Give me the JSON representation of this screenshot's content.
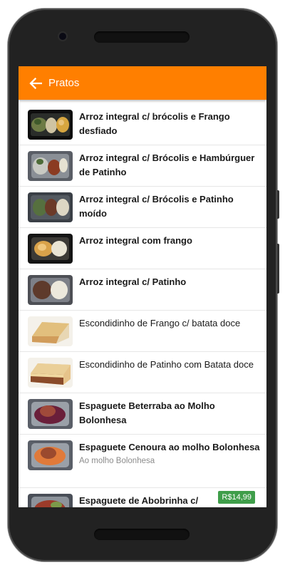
{
  "app": {
    "title": "Pratos"
  },
  "items": [
    {
      "title": "Arroz integral c/ brócolis e Frango desfiado",
      "icon": "rice-broccoli-chicken-photo"
    },
    {
      "title": "Arroz integral c/ Brócolis e Hambúrguer de Patinho",
      "icon": "rice-broccoli-burger-photo"
    },
    {
      "title": "Arroz integral c/ Brócolis e Patinho moído",
      "icon": "rice-broccoli-ground-beef-photo"
    },
    {
      "title": "Arroz integral com frango",
      "icon": "rice-chicken-photo"
    },
    {
      "title": "Arroz integral c/ Patinho",
      "icon": "rice-beef-photo"
    },
    {
      "title": "Escondidinho de Frango c/ batata doce",
      "icon": "escondidinho-chicken-photo"
    },
    {
      "title": "Escondidinho de Patinho com Batata doce",
      "icon": "escondidinho-beef-photo"
    },
    {
      "title": "Espaguete Beterraba ao Molho Bolonhesa",
      "icon": "beet-spaghetti-photo"
    },
    {
      "title": "Espaguete Cenoura ao molho Bolonhesa",
      "subtitle": "Ao molho Bolonhesa",
      "icon": "carrot-spaghetti-photo"
    },
    {
      "title": "Espaguete de Abobrinha c/",
      "price": "R$14,99",
      "icon": "zucchini-spaghetti-photo"
    }
  ],
  "colors": {
    "appbar": "#ff7f00",
    "price_badge": "#3f9e4a"
  }
}
